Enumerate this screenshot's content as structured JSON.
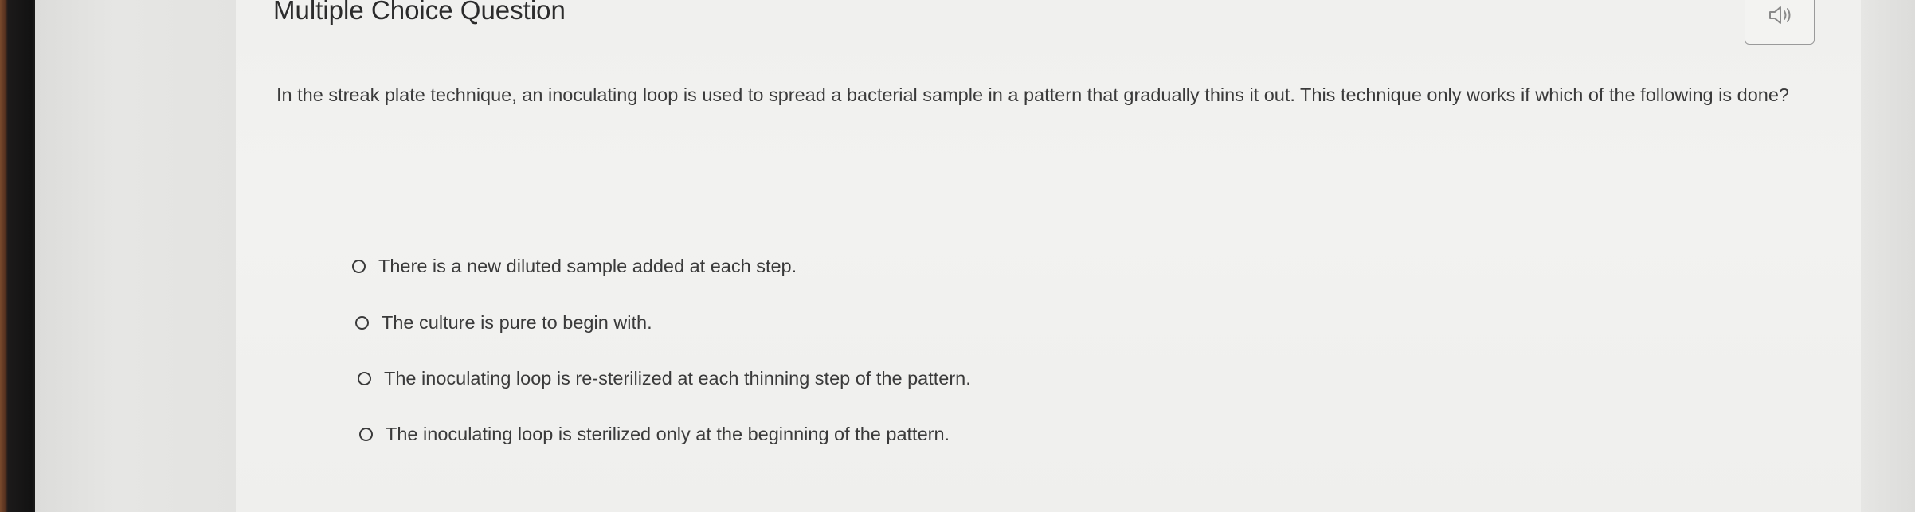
{
  "header": {
    "title": "Multiple Choice Question",
    "audio_icon": "speaker-icon"
  },
  "question": {
    "text": "In the streak plate technique, an inoculating loop is used to spread a bacterial sample in a pattern that gradually thins it out. This technique only works if which of the following is done?"
  },
  "options": [
    {
      "label": "There is a new diluted sample added at each step.",
      "selected": false
    },
    {
      "label": "The culture is pure to begin with.",
      "selected": false
    },
    {
      "label": "The inoculating loop is re-sterilized at each thinning step of the pattern.",
      "selected": false
    },
    {
      "label": "The inoculating loop is sterilized only at the beginning of the pattern.",
      "selected": false
    }
  ],
  "colors": {
    "text": "#3a3a3a",
    "background": "#f1f1ef",
    "button_border": "#9a9a9a"
  }
}
